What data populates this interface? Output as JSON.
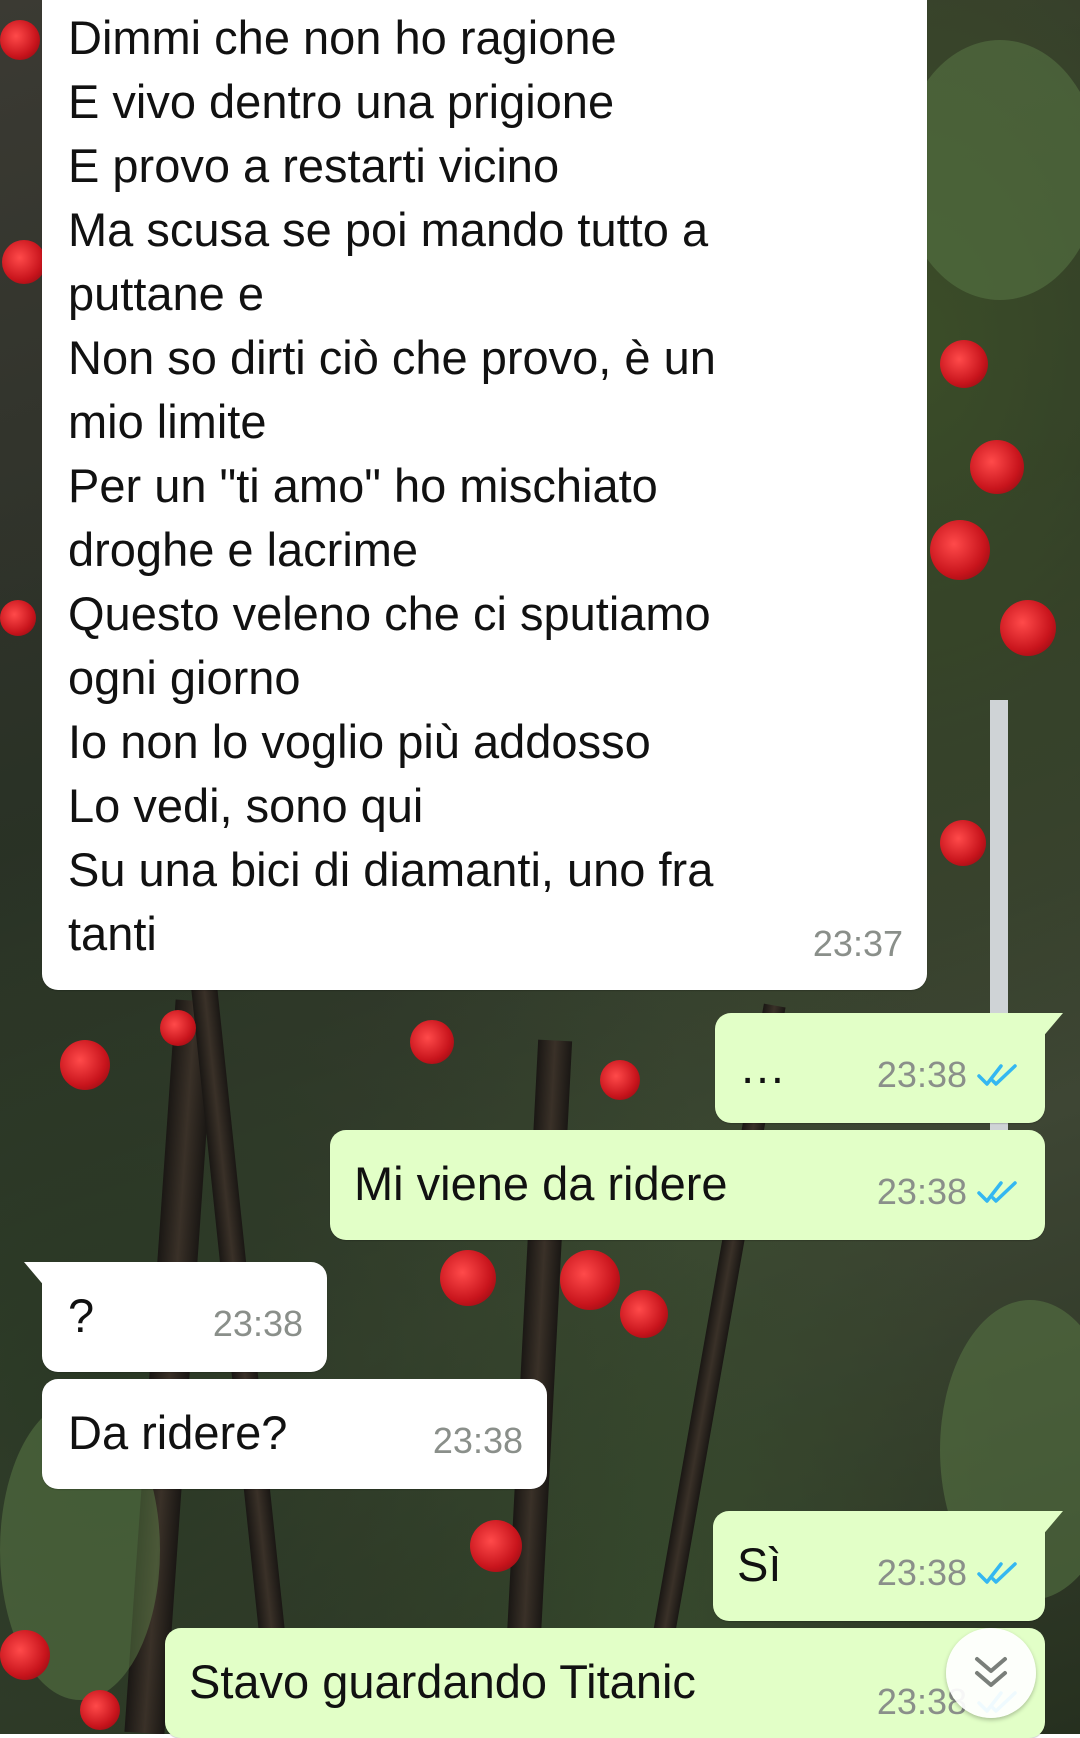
{
  "messages": [
    {
      "direction": "in",
      "text": "Dimmi che non ho ragione\nE vivo dentro una prigione\nE provo a restarti vicino\nMa scusa se poi mando tutto a\nputtane e\nNon so dirti ciò che provo, è un\nmio limite\nPer un \"ti amo\" ho mischiato\ndroghe e lacrime\nQuesto veleno che ci sputiamo\nogni giorno\nIo non lo voglio più addosso\nLo vedi, sono qui\nSu una bici di diamanti, uno fra\ntanti",
      "time": "23:37"
    },
    {
      "direction": "out",
      "text": "…",
      "time": "23:38",
      "status": "read"
    },
    {
      "direction": "out",
      "text": "Mi viene da ridere",
      "time": "23:38",
      "status": "read"
    },
    {
      "direction": "in",
      "text": "?",
      "time": "23:38"
    },
    {
      "direction": "in",
      "text": "Da ridere?",
      "time": "23:38"
    },
    {
      "direction": "out",
      "text": "Sì",
      "time": "23:38",
      "status": "read"
    },
    {
      "direction": "out",
      "text": "Stavo guardando Titanic",
      "time": "23:38",
      "status": "read"
    }
  ],
  "icons": {
    "read_receipt": "double-check-icon",
    "scroll_down": "chevron-double-down-icon"
  },
  "colors": {
    "incoming_bubble": "#ffffff",
    "outgoing_bubble": "#e2ffc7",
    "read_tick": "#34b7f1",
    "timestamp": "#8a8f8a"
  }
}
